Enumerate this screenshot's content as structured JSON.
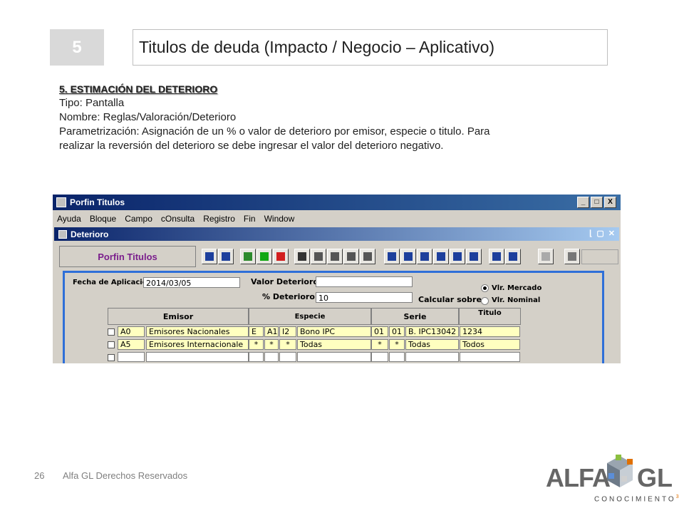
{
  "slide": {
    "number": "5",
    "title": "Titulos de deuda (Impacto / Negocio – Aplicativo)",
    "heading": "5. ESTIMACIÓN DEL DETERIORO",
    "lines": [
      "Tipo: Pantalla",
      "Nombre: Reglas/Valoración/Deterioro",
      "Parametrización: Asignación de un % o valor de deterioro por emisor, especie o titulo. Para",
      "realizar la reversión del deterioro se debe ingresar el valor del deterioro negativo."
    ]
  },
  "app": {
    "window_title": "Porfin Titulos",
    "window_buttons": [
      "_",
      "□",
      "X"
    ],
    "menu": [
      "Ayuda",
      "Bloque",
      "Campo",
      "cOnsulta",
      "Registro",
      "Fin",
      "Window"
    ],
    "inner_title": "Deterioro",
    "brand": "Porfin Titulos",
    "form": {
      "fecha_label": "Fecha de Aplicación",
      "fecha_value": "2014/03/05",
      "valor_label": "Valor Deterioro",
      "valor_value": "",
      "pct_label": "% Deterioro",
      "pct_value": "10",
      "calc_label": "Calcular sobre",
      "radio_options": [
        "Vlr. Mercado",
        "Vlr. Nominal"
      ],
      "radio_selected": "Vlr. Mercado"
    },
    "grid": {
      "headers": [
        "Emisor",
        "Especie",
        "Serie",
        "Titulo"
      ],
      "rows": [
        [
          "A0",
          "Emisores Nacionales",
          "E",
          "A1",
          "I2",
          "Bono IPC",
          "01",
          "01",
          "B. IPC13042",
          "1234"
        ],
        [
          "A5",
          "Emisores Internacionale",
          "*",
          "*",
          "*",
          "Todas",
          "*",
          "*",
          "Todas",
          "Todos"
        ]
      ]
    }
  },
  "footer": {
    "page": "26",
    "text": "Alfa GL Derechos Reservados"
  },
  "logo": {
    "left": "ALFA",
    "right": "GL",
    "sub": "CONOCIMIENTO",
    "sup": "3"
  },
  "colors": {
    "accent_blue": "#2e6fd8",
    "field_yellow": "#ffffc0",
    "brand_purple": "#7a1e8c"
  }
}
